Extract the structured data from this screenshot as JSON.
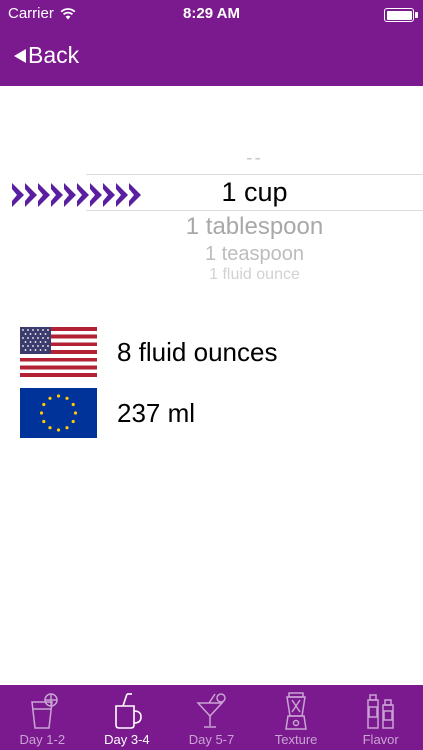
{
  "status_bar": {
    "carrier": "Carrier",
    "time": "8:29 AM",
    "battery_level": 1.0
  },
  "nav": {
    "back_label": "Back"
  },
  "picker": {
    "options": [
      "--",
      "1 cup",
      "1 tablespoon",
      "1 teaspoon",
      "1 fluid ounce"
    ],
    "selected": "1 cup"
  },
  "results": [
    {
      "flag": "us-flag",
      "text": "8 fluid ounces"
    },
    {
      "flag": "eu-flag",
      "text": "237 ml"
    }
  ],
  "tabs": [
    {
      "label": "Day 1-2",
      "icon": "cocktail-glass-icon",
      "active": false
    },
    {
      "label": "Day 3-4",
      "icon": "mug-icon",
      "active": true
    },
    {
      "label": "Day 5-7",
      "icon": "martini-glass-icon",
      "active": false
    },
    {
      "label": "Texture",
      "icon": "blender-icon",
      "active": false
    },
    {
      "label": "Flavor",
      "icon": "bottles-icon",
      "active": false
    }
  ],
  "colors": {
    "brand": "#7b1a8e",
    "chevron": "#5a1fa0",
    "tab_inactive": "#c9a3d3"
  }
}
